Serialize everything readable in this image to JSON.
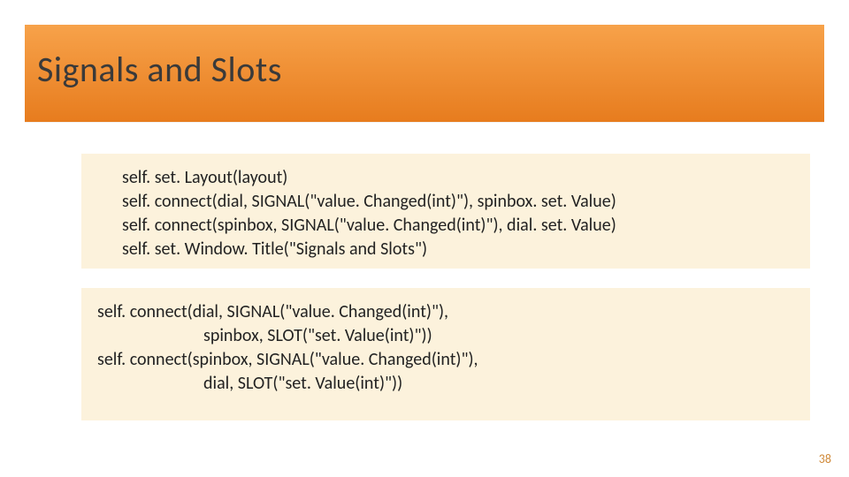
{
  "title": "Signals and Slots",
  "code_block_1": {
    "l1": "self. set. Layout(layout)",
    "l2": "self. connect(dial, SIGNAL(\"value. Changed(int)\"), spinbox. set. Value)",
    "l3": "self. connect(spinbox, SIGNAL(\"value. Changed(int)\"), dial. set. Value)",
    "l4": "self. set. Window. Title(\"Signals and Slots\")"
  },
  "code_block_2": {
    "l1": "self. connect(dial, SIGNAL(\"value. Changed(int)\"),",
    "l2": "spinbox, SLOT(\"set. Value(int)\"))",
    "l3": "self. connect(spinbox, SIGNAL(\"value. Changed(int)\"),",
    "l4": "dial, SLOT(\"set. Value(int)\"))"
  },
  "page_number": "38"
}
